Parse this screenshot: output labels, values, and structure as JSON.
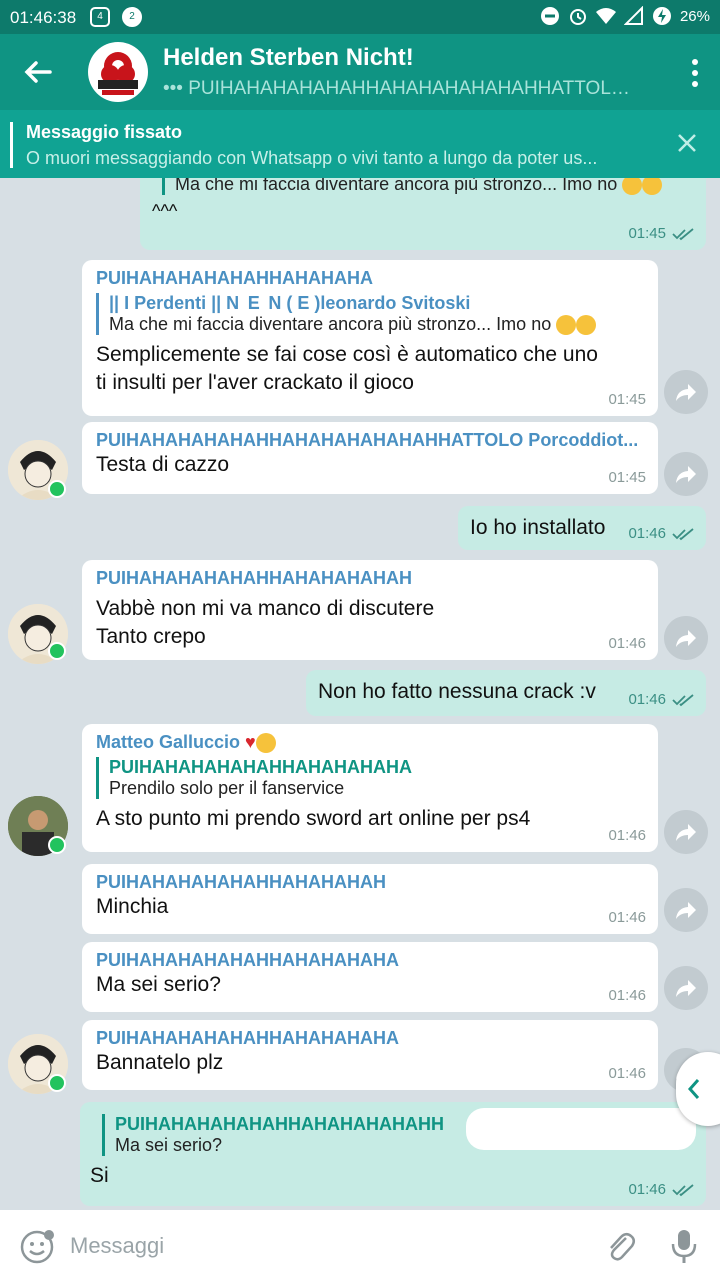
{
  "status_bar": {
    "time": "01:46:38",
    "notif1": "4",
    "notif2": "2",
    "battery": "26%"
  },
  "header": {
    "title": "Helden Sterben Nicht!",
    "subtitle": "••• PUIHAHAHAHAHAHHAHAHAHAHAHAHHATTOLO,..."
  },
  "pinned": {
    "label": "Messaggio fissato",
    "text": "O muori messaggiando con Whatsapp o vivi tanto a lungo da poter us..."
  },
  "messages": [
    {
      "dir": "out",
      "quote_text": "Ma che mi faccia diventare ancora più stronzo... Imo no",
      "text": "^^^",
      "time": "01:45"
    },
    {
      "dir": "in",
      "sender": "PUIHAHAHAHAHAHHAHAHAHA",
      "quote_name": "|| I Perdenti || N  E  N ( E )leonardo Svitoski",
      "quote_text": "Ma che mi faccia diventare ancora più stronzo... Imo no",
      "text": "Semplicemente se fai cose così è automatico che uno ti insulti per l'aver crackato il gioco",
      "time": "01:45"
    },
    {
      "dir": "in",
      "sender": "PUIHAHAHAHAHAHHAHAHAHAHAHAHHATTOLO Porcoddiot...",
      "text": "Testa di cazzo",
      "time": "01:45"
    },
    {
      "dir": "out",
      "text": "Io ho installato",
      "time": "01:46"
    },
    {
      "dir": "in",
      "sender": "PUIHAHAHAHAHAHHAHAHAHAHAH",
      "text": "Vabbè non mi va manco di discutere\nTanto crepo",
      "time": "01:46"
    },
    {
      "dir": "out",
      "text": "Non ho fatto nessuna crack :v",
      "time": "01:46"
    },
    {
      "dir": "in",
      "sender": "Matteo Galluccio",
      "quote_name": "PUIHAHAHAHAHAHHAHAHAHAHA",
      "quote_text": "Prendilo solo per il fanservice",
      "text": "A sto punto mi prendo sword art online per ps4",
      "time": "01:46"
    },
    {
      "dir": "in",
      "sender": "PUIHAHAHAHAHAHHAHAHAHAH",
      "text": "Minchia",
      "time": "01:46"
    },
    {
      "dir": "in",
      "sender": "PUIHAHAHAHAHAHHAHAHAHAHA",
      "text": "Ma sei serio?",
      "time": "01:46"
    },
    {
      "dir": "in",
      "sender": "PUIHAHAHAHAHAHHAHAHAHAHA",
      "text": "Bannatelo plz",
      "time": "01:46"
    },
    {
      "dir": "out",
      "quote_name": "PUIHAHAHAHAHAHHAHAHAHAHAHH",
      "quote_text": "Ma sei serio?",
      "text": "Si",
      "time": "01:46"
    }
  ],
  "input": {
    "placeholder": "Messaggi"
  },
  "colors": {
    "header": "#0f9483",
    "statusbar": "#0d7a6b",
    "pinned": "#10a393",
    "outgoing": "#c6ebe4",
    "sender": "#4a90c2"
  }
}
